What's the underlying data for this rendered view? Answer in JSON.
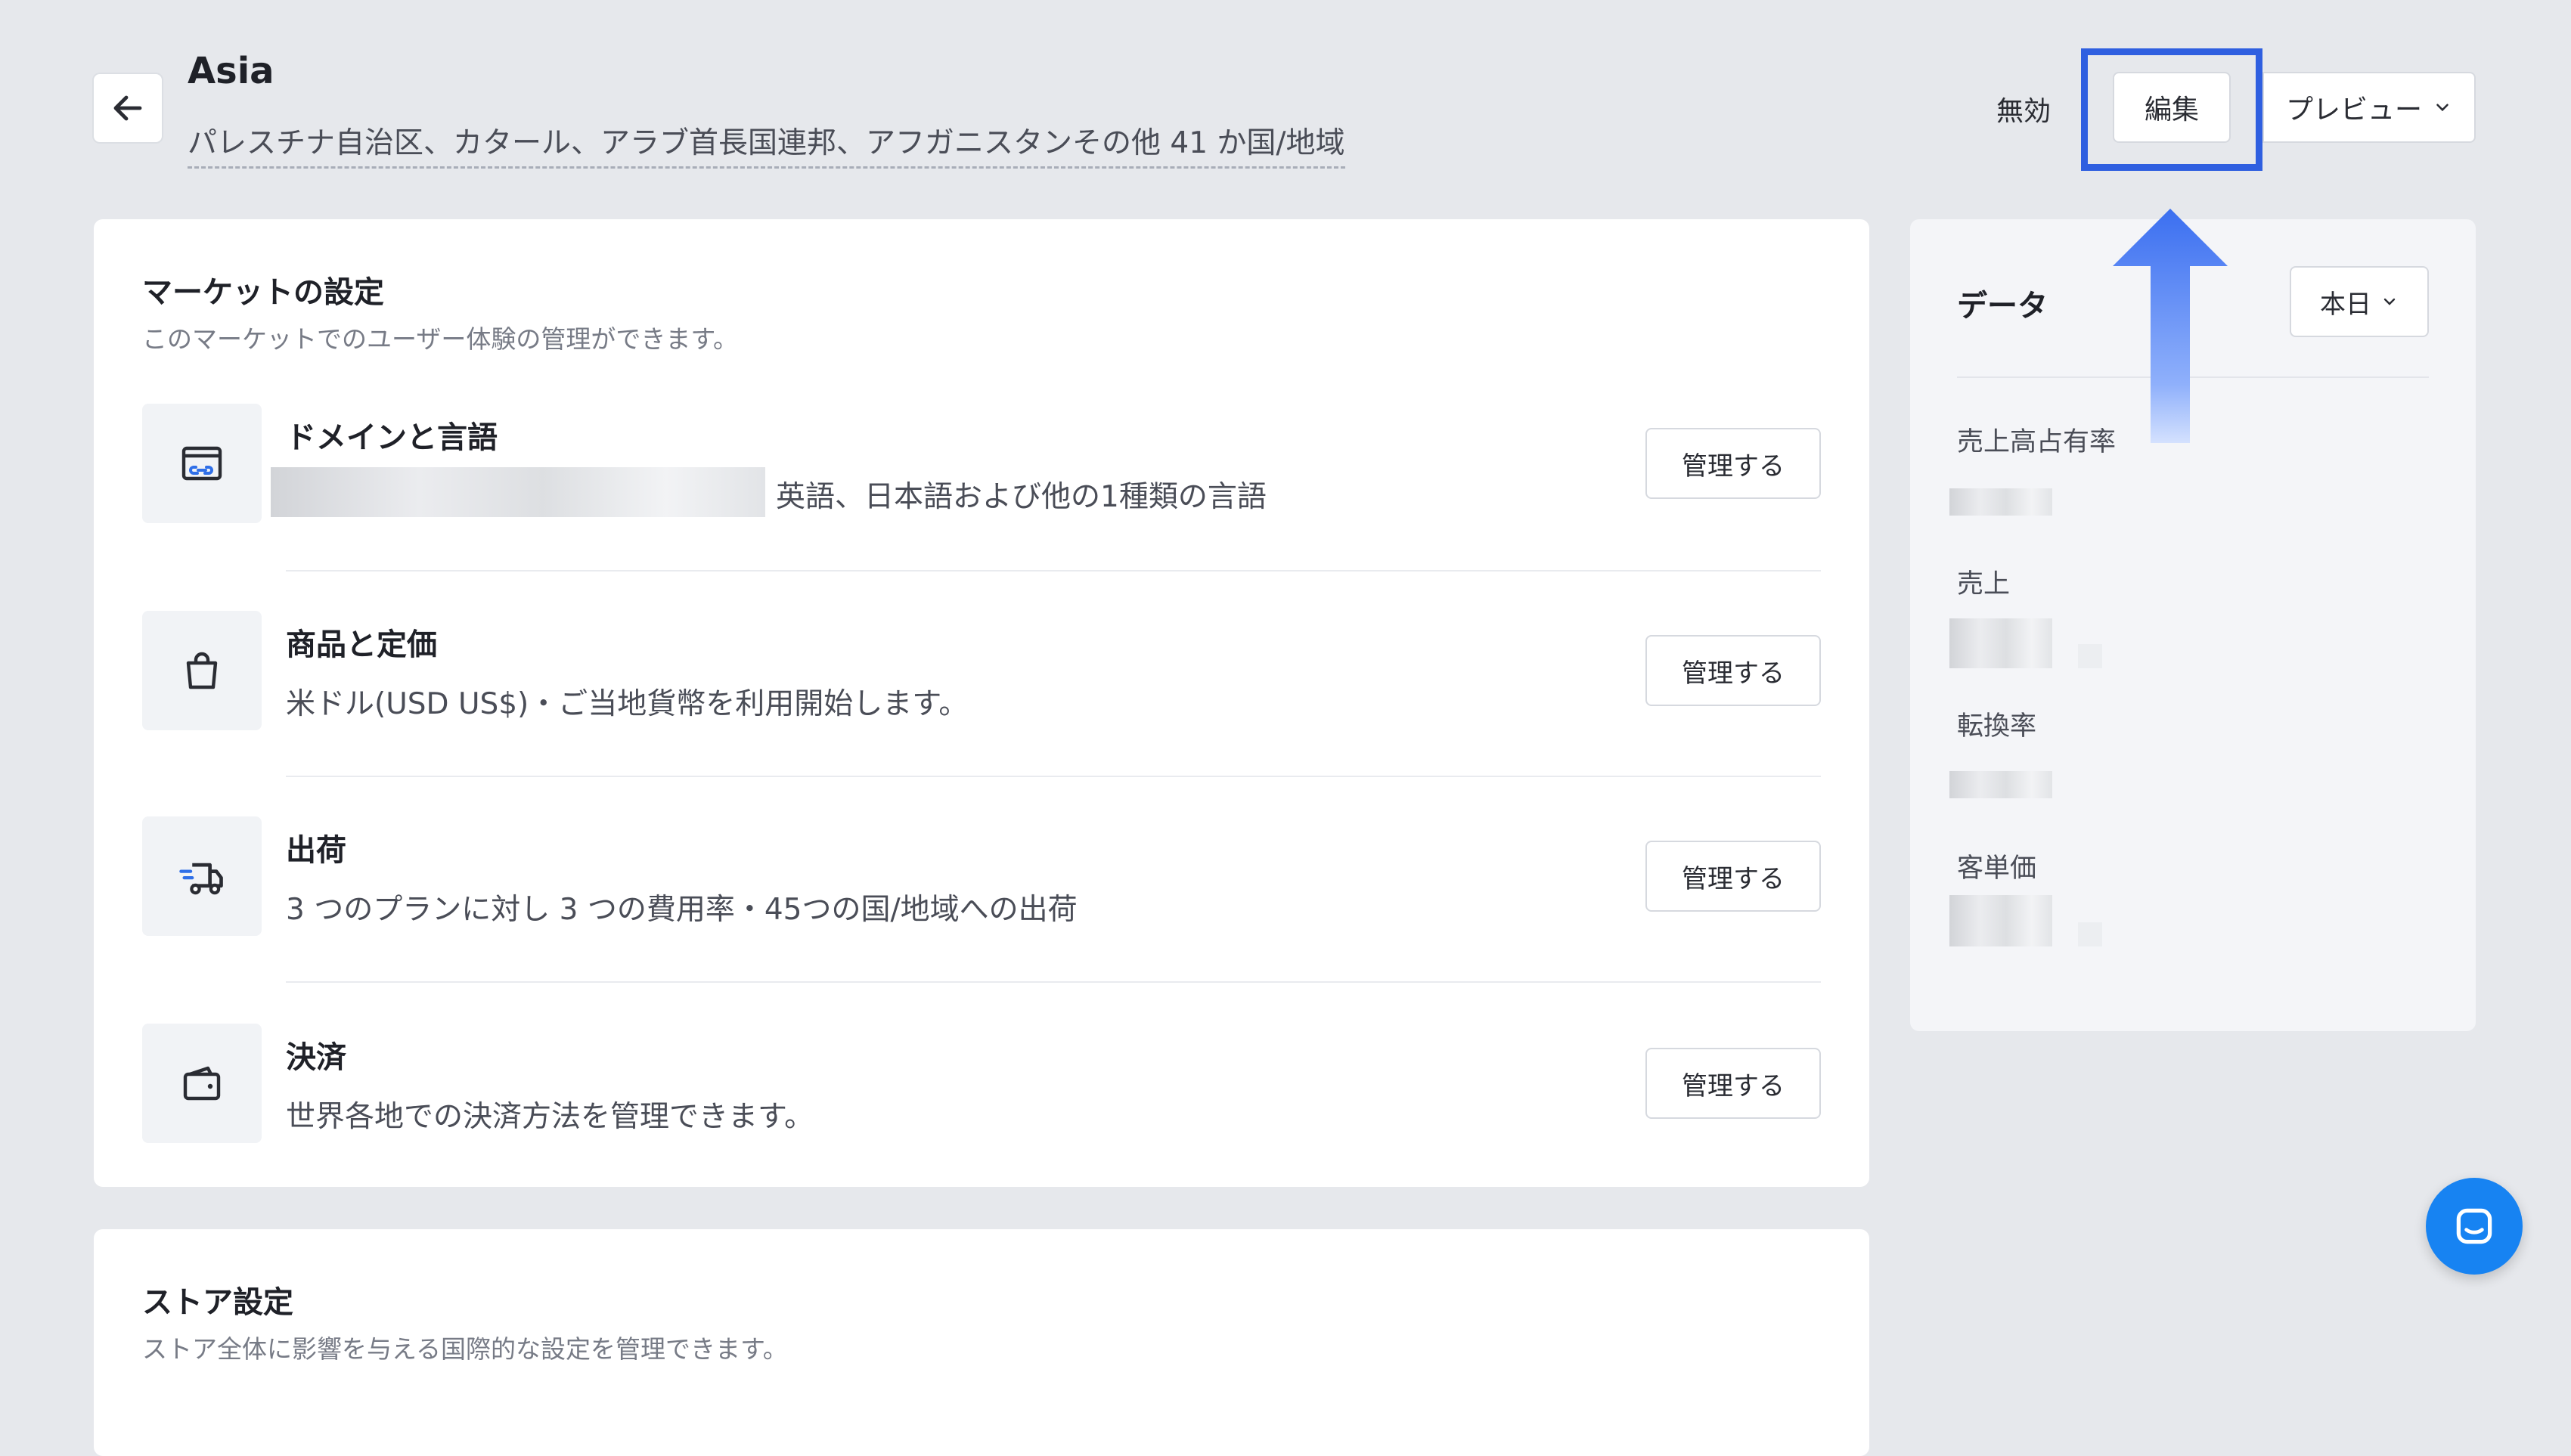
{
  "header": {
    "title": "Asia",
    "subtitle": "パレスチナ自治区、カタール、アラブ首長国連邦、アフガニスタンその他 41 か国/地域",
    "disable_label": "無効",
    "edit_label": "編集",
    "preview_label": "プレビュー"
  },
  "market_settings": {
    "title": "マーケットの設定",
    "description": "このマーケットでのユーザー体験の管理ができます。",
    "manage_label": "管理する",
    "rows": [
      {
        "title": "ドメインと言語",
        "description": "英語、日本語および他の1種類の言語",
        "icon": "domain-link-icon"
      },
      {
        "title": "商品と定価",
        "description": "米ドル(USD US$)・ご当地貨幣を利用開始します。",
        "icon": "shopping-bag-icon"
      },
      {
        "title": "出荷",
        "description": "3 つのプランに対し 3 つの費用率・45つの国/地域への出荷",
        "icon": "delivery-truck-icon"
      },
      {
        "title": "決済",
        "description": "世界各地での決済方法を管理できます。",
        "icon": "wallet-icon"
      }
    ]
  },
  "store_settings": {
    "title": "ストア設定",
    "description": "ストア全体に影響を与える国際的な設定を管理できます。"
  },
  "data_panel": {
    "title": "データ",
    "period_label": "本日",
    "metrics": [
      "売上高占有率",
      "売上",
      "転換率",
      "客単価"
    ]
  },
  "colors": {
    "highlight": "#2f5fe0",
    "arrow": "#3b6ff0",
    "chat": "#1783f2",
    "background": "#e6e8ec"
  }
}
